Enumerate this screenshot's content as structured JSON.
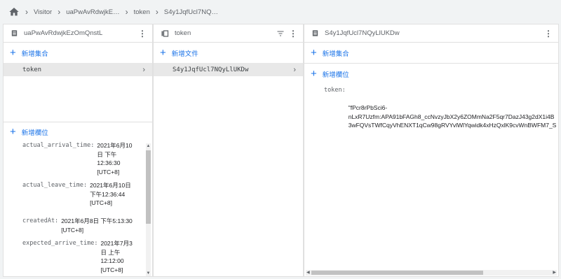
{
  "breadcrumb": {
    "items": [
      "Visitor",
      "uaPwAvRdwjkE…",
      "token",
      "S4y1JqfUcl7NQ…"
    ]
  },
  "panel1": {
    "title": "uaPwAvRdwjkEzOmQnstL",
    "add_collection": "新增集合",
    "items": [
      {
        "label": "token"
      }
    ],
    "add_field": "新增欄位",
    "fields": [
      {
        "key": "actual_arrival_time:",
        "value": [
          "2021年6月10",
          "日 下午",
          "12:36:30",
          "[UTC+8]"
        ]
      },
      {
        "key": "actual_leave_time:",
        "value": [
          "2021年6月10日",
          "下午12:36:44",
          "[UTC+8]"
        ]
      },
      {
        "key": "createdAt:",
        "value": [
          "2021年6月8日 下午5:13:30",
          "[UTC+8]"
        ]
      },
      {
        "key": "expected_arrive_time:",
        "value": [
          "2021年7月3",
          "日 上午",
          "12:12:00",
          "[UTC+8]"
        ]
      }
    ]
  },
  "panel2": {
    "title": "token",
    "add_document": "新增文件",
    "items": [
      {
        "label": "S4y1JqfUcl7NQyLlUKDw"
      }
    ]
  },
  "panel3": {
    "title": "S4y1JqfUcl7NQyLlUKDw",
    "add_collection": "新增集合",
    "add_field": "新增欄位",
    "token_field": {
      "key": "token:",
      "value": [
        "\"fPcr8rPbSci6-",
        "nLxR7Uzfm:APA91bFAGh8_ccNvzyJbX2y6ZOMmNa2F5qr7DazJ43g2dX1i4B",
        "3wFQVsTWfCqyVhENXT1qCw98gRVYvlWlYqwidk4xHzQxlK9cvWnBWFM7_S"
      ]
    }
  }
}
